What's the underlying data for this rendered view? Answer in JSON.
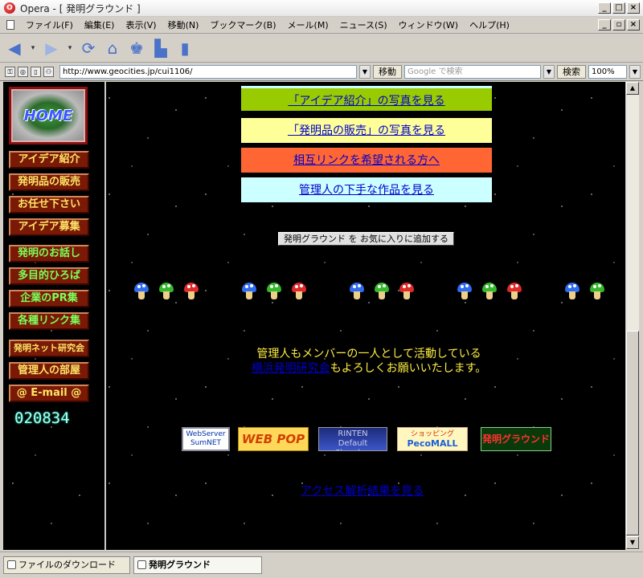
{
  "window": {
    "title": "Opera - [ 発明グラウンド ]",
    "min": "_",
    "max": "□",
    "close": "×",
    "restore": "▫"
  },
  "menu": [
    "ファイル(F)",
    "編集(E)",
    "表示(V)",
    "移動(N)",
    "ブックマーク(B)",
    "メール(M)",
    "ニュース(S)",
    "ウィンドウ(W)",
    "ヘルプ(H)"
  ],
  "toolbar": {
    "back_icon": "back-arrow-icon",
    "forward_icon": "forward-arrow-icon",
    "reload_icon": "reload-icon",
    "home_icon": "home-icon",
    "hotlist_icon": "hotlist-icon",
    "print_icon": "print-icon",
    "notes_icon": "note-icon"
  },
  "address": {
    "url": "http://www.geocities.jp/cui1106/",
    "go_label": "移動",
    "search_placeholder": "Google で検索",
    "search_button": "検索",
    "zoom": "100%"
  },
  "sidebar": {
    "home_label": "HOME",
    "items": [
      {
        "label": "アイデア紹介",
        "color": "#ffe566"
      },
      {
        "label": "発明品の販売",
        "color": "#ffe566"
      },
      {
        "label": "お任せ下さい",
        "color": "#ffe566"
      },
      {
        "label": "アイデア募集",
        "color": "#ffe566"
      },
      {
        "label": "発明のお話し",
        "color": "#7cff5a"
      },
      {
        "label": "多目的ひろば",
        "color": "#7cff5a"
      },
      {
        "label": "企業のPR集",
        "color": "#7cff5a"
      },
      {
        "label": "各種リンク集",
        "color": "#7cff5a"
      },
      {
        "label": "発明ネット研究会",
        "color": "#ffe566"
      },
      {
        "label": "管理人の部屋",
        "color": "#ffe566"
      },
      {
        "label": "@ E-mail @",
        "color": "#ffe566"
      }
    ],
    "counter": "020834"
  },
  "links": [
    {
      "label": "「アイデア紹介」の写真を見る",
      "bg": "#99cc00"
    },
    {
      "label": "「発明品の販売」の写真を見る",
      "bg": "#ffff99"
    },
    {
      "label": "相互リンクを希望される方へ",
      "bg": "#ff6633"
    },
    {
      "label": "管理人の下手な作品を見る",
      "bg": "#ccffff"
    }
  ],
  "favorite_button": "発明グラウンド を お気に入りに追加する",
  "message": {
    "line1": "管理人もメンバーの一人として活動している",
    "link": "横浜発明研究会",
    "line2_rest": "もよろしくお願いいたします。"
  },
  "banners": {
    "webserver_line1": "WebServer",
    "webserver_line2": "SumNET",
    "webpop": "WEB POP",
    "rinten_line1": "RINTEN",
    "rinten_line2": "Default Chamber",
    "shopping_line1": "ショッピング",
    "shopping_line2": "PecoMALL",
    "hatsumei": "発明グラウンド"
  },
  "access_link": "アクセス解析結果を見る",
  "tabs": {
    "download": "ファイルのダウンロード",
    "active": "発明グラウンド"
  },
  "mushroom_colors": [
    "#2f6cf0",
    "#35b82c",
    "#e02a2a"
  ]
}
